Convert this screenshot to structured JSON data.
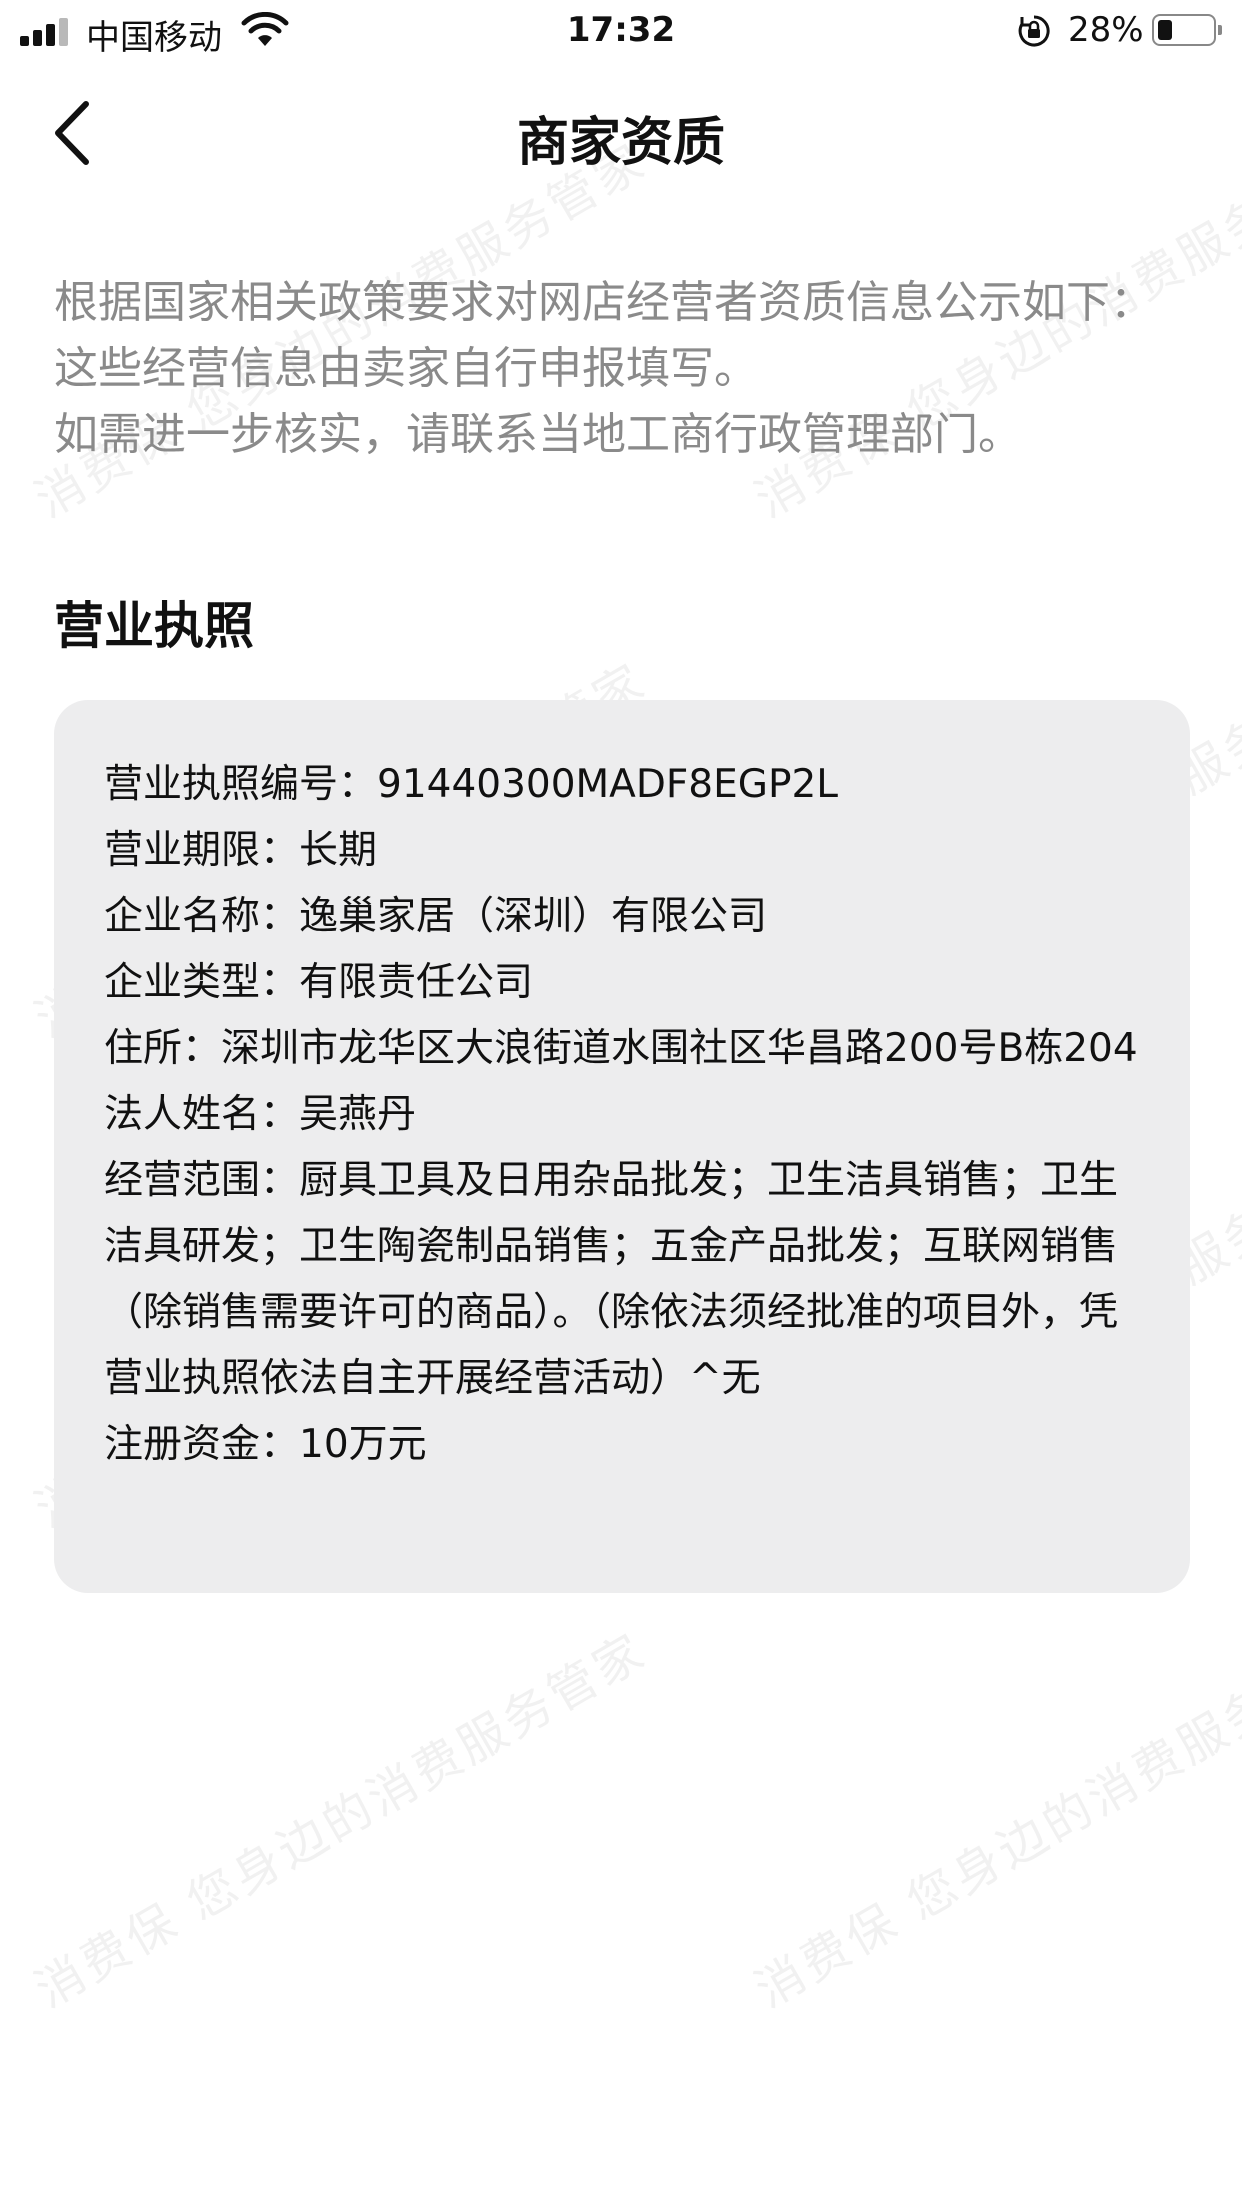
{
  "status_bar": {
    "carrier": "中国移动",
    "time": "17:32",
    "battery_percent": "28%",
    "battery_level": 0.28,
    "signal_bars": 3,
    "signal_bars_total": 4
  },
  "nav": {
    "title": "商家资质"
  },
  "intro": {
    "lines": [
      "根据国家相关政策要求对网店经营者资质信息公示如下：",
      "这些经营信息由卖家自行申报填写。",
      "如需进一步核实，请联系当地工商行政管理部门。"
    ]
  },
  "section": {
    "heading": "营业执照"
  },
  "license": {
    "fields": [
      "营业执照编号：91440300MADF8EGP2L",
      "营业期限：长期",
      "企业名称：逸巢家居（深圳）有限公司",
      "企业类型：有限责任公司",
      "住所：深圳市龙华区大浪街道水围社区华昌路200号B栋204",
      "法人姓名：吴燕丹",
      "经营范围：厨具卫具及日用杂品批发；卫生洁具销售；卫生洁具研发；卫生陶瓷制品销售；五金产品批发；互联网销售（除销售需要许可的商品）。（除依法须经批准的项目外，凭营业执照依法自主开展经营活动）^无",
      "注册资金：10万元"
    ]
  },
  "watermark": {
    "text": "消费保 您身边的消费服务管家"
  },
  "colors": {
    "background": "#ffffff",
    "card": "#ededee",
    "intro_text": "#8a8a8a",
    "text": "#111111"
  },
  "icons": [
    "signal-icon",
    "wifi-icon",
    "orientation-lock-icon",
    "battery-icon",
    "back-chevron-icon"
  ]
}
